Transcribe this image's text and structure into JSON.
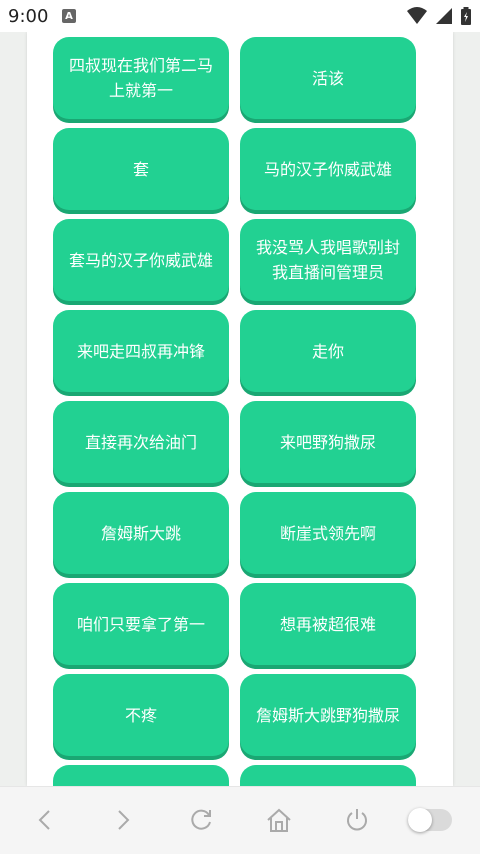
{
  "status_bar": {
    "time": "9:00",
    "app_icon": "A"
  },
  "buttons": [
    "四叔现在我们第二马上就第一",
    "活该",
    "套",
    "马的汉子你威武雄",
    "套马的汉子你威武雄",
    "我没骂人我唱歌别封我直播间管理员",
    "来吧走四叔再冲锋",
    "走你",
    "直接再次给油门",
    "来吧野狗撒尿",
    "詹姆斯大跳",
    "断崖式领先啊",
    "咱们只要拿了第一",
    "想再被超很难",
    "不疼",
    "詹姆斯大跳野狗撒尿",
    "",
    ""
  ],
  "nav_icons": [
    "back-icon",
    "forward-icon",
    "refresh-icon",
    "home-icon",
    "power-icon",
    "toggle"
  ],
  "colors": {
    "button": "#22d192",
    "button_shadow": "#1aa773",
    "page_bg": "#eef0ee"
  }
}
